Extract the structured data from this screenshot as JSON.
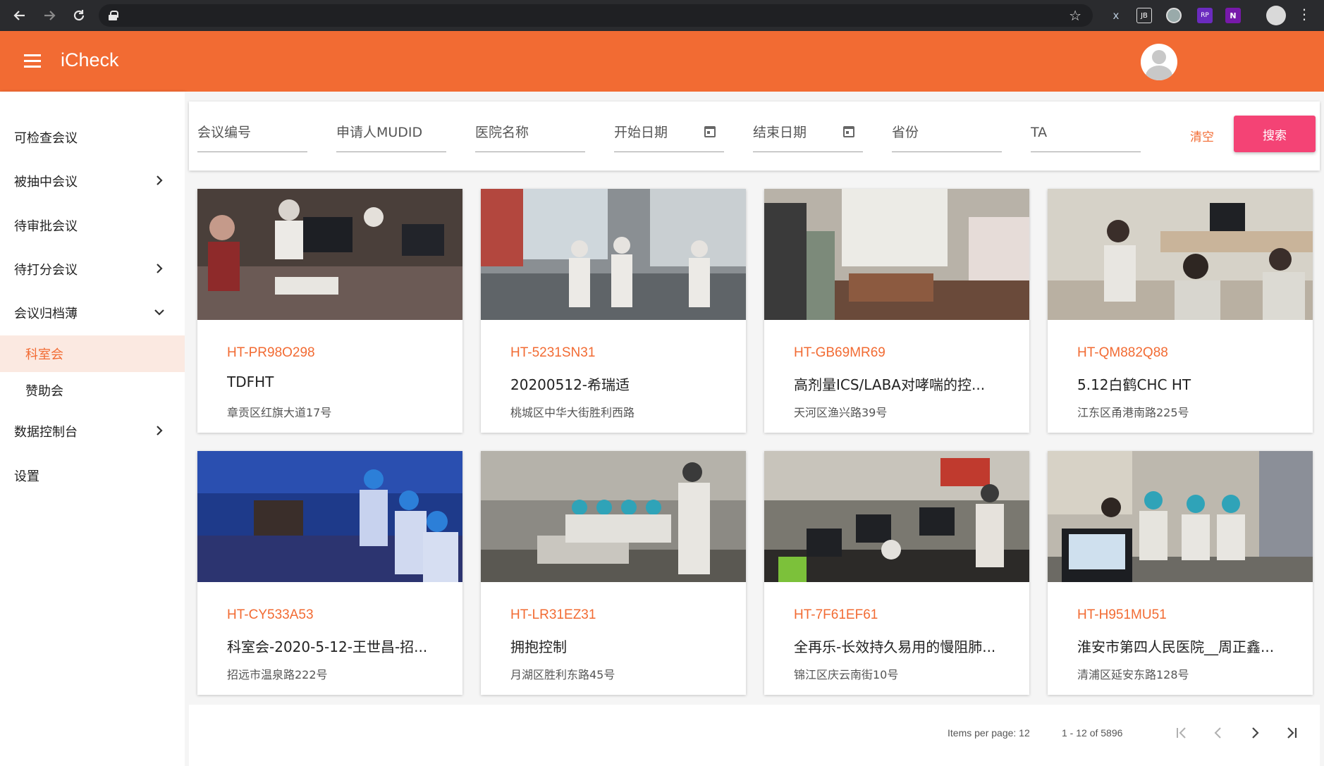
{
  "app": {
    "title": "iCheck"
  },
  "sidebar": {
    "items": [
      {
        "label": "可检查会议"
      },
      {
        "label": "被抽中会议"
      },
      {
        "label": "待审批会议"
      },
      {
        "label": "待打分会议"
      },
      {
        "label": "会议归档薄"
      },
      {
        "label": "科室会"
      },
      {
        "label": "赞助会"
      },
      {
        "label": "数据控制台"
      },
      {
        "label": "设置"
      }
    ]
  },
  "filters": {
    "meeting_no": "会议编号",
    "applicant": "申请人MUDID",
    "hospital": "医院名称",
    "start_date": "开始日期",
    "end_date": "结束日期",
    "province": "省份",
    "ta": "TA",
    "clear_label": "清空",
    "search_label": "搜索"
  },
  "cards": [
    {
      "code": "HT-PR98O298",
      "name": "TDFHT",
      "addr": "章贡区红旗大道17号"
    },
    {
      "code": "HT-5231SN31",
      "name": "20200512-希瑞适",
      "addr": "桃城区中华大街胜利西路"
    },
    {
      "code": "HT-GB69MR69",
      "name": "高剂量ICS/LABA对哮喘的控...",
      "addr": "天河区渔兴路39号"
    },
    {
      "code": "HT-QM882Q88",
      "name": "5.12白鹤CHC HT",
      "addr": "江东区甬港南路225号"
    },
    {
      "code": "HT-CY533A53",
      "name": "科室会-2020-5-12-王世昌-招...",
      "addr": "招远市温泉路222号"
    },
    {
      "code": "HT-LR31EZ31",
      "name": "拥抱控制",
      "addr": "月湖区胜利东路45号"
    },
    {
      "code": "HT-7F61EF61",
      "name": "全再乐-长效持久易用的慢阻肺...",
      "addr": "锦江区庆云南街10号"
    },
    {
      "code": "HT-H951MU51",
      "name": "淮安市第四人民医院__周正鑫...",
      "addr": "清浦区延安东路128号"
    }
  ],
  "paginator": {
    "items_per_page": "Items per page: 12",
    "range": "1 - 12 of 5896"
  },
  "colors": {
    "accent": "#f26b33",
    "search_button": "#f44375"
  }
}
